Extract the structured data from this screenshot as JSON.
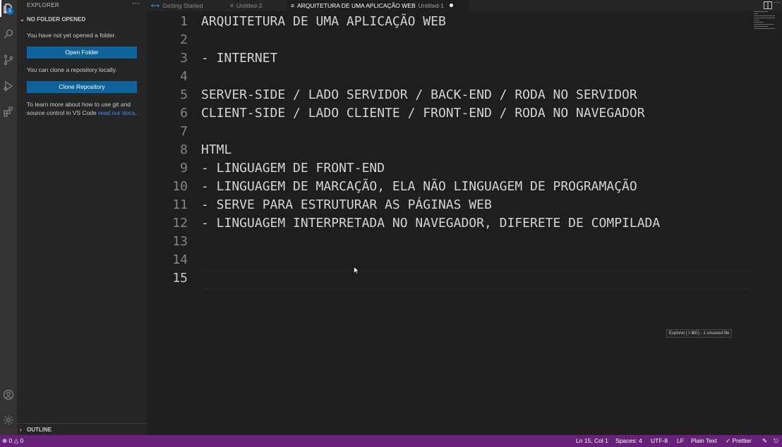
{
  "sidebar": {
    "title": "EXPLORER",
    "more": "···",
    "section": "NO FOLDER OPENED",
    "msg1": "You have not yet opened a folder.",
    "open_folder": "Open Folder",
    "msg2": "You can clone a repository locally.",
    "clone_repo": "Clone Repository",
    "msg3": "To learn more about how to use git and source control in VS Code ",
    "msg3_link": "read our docs",
    "msg3_end": ".",
    "outline": "OUTLINE",
    "explorer_badge": "1"
  },
  "tabs": [
    {
      "label": "Getting Started",
      "sub": ""
    },
    {
      "label": "Untitled-2",
      "sub": ""
    },
    {
      "label": "ARQUITETURA DE UMA APLICAÇÃO WEB",
      "sub": "Untitled-1"
    }
  ],
  "editor": {
    "lines": [
      "ARQUITETURA DE UMA APLICAÇÃO WEB",
      "",
      "- INTERNET",
      "",
      "SERVER-SIDE / LADO SERVIDOR / BACK-END / RODA NO SERVIDOR",
      "CLIENT-SIDE / LADO CLIENTE / FRONT-END / RODA NO NAVEGADOR",
      "",
      "HTML",
      "- LINGUAGEM DE FRONT-END",
      "- LINGUAGEM DE MARCAÇÃO, ELA NÃO LINGUAGEM DE PROGRAMAÇÃO",
      "- SERVE PARA ESTRUTURAR AS PÁGINAS WEB",
      "- LINGUAGEM INTERPRETADA NO NAVEGADOR, DIFERETE DE COMPILADA",
      "",
      "",
      ""
    ],
    "current_line": 15,
    "tooltip": "Explorer (⇧⌘E) - 1 unsaved file"
  },
  "status": {
    "errors": "0",
    "warnings": "0",
    "position": "Ln 15, Col 1",
    "spaces": "Spaces: 4",
    "encoding": "UTF-8",
    "eol": "LF",
    "language": "Plain Text",
    "prettier": "✓ Prettier"
  },
  "colors": {
    "statusbar": "#68217a",
    "button": "#0e639c",
    "activity_bar": "#333333",
    "sidebar": "#252526",
    "editor": "#1e1e1e"
  }
}
